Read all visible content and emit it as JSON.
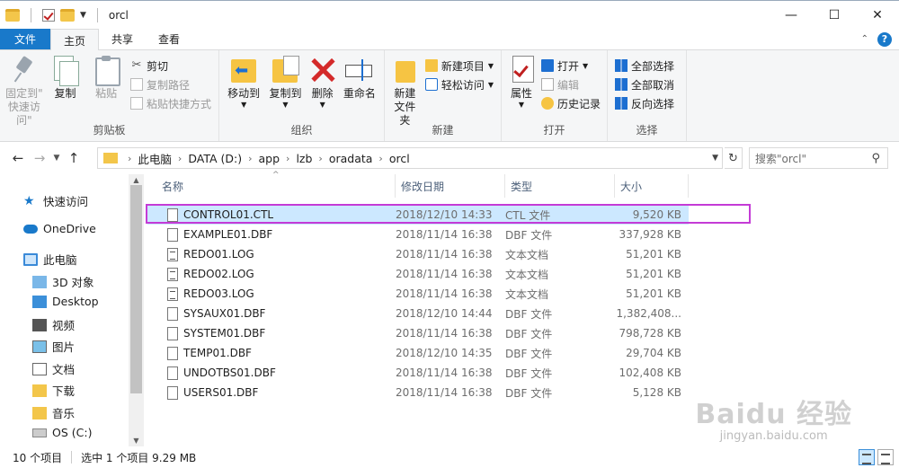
{
  "window": {
    "title": "orcl",
    "minimize": "—",
    "maximize": "☐",
    "close": "✕"
  },
  "ribbon_tabs": [
    {
      "label": "文件"
    },
    {
      "label": "主页"
    },
    {
      "label": "共享"
    },
    {
      "label": "查看"
    }
  ],
  "ribbon": {
    "clipboard": {
      "label": "剪贴板",
      "pin": "固定到\"\n快速访问\"",
      "copy": "复制",
      "paste": "粘贴",
      "cut": "剪切",
      "copy_path": "复制路径",
      "paste_shortcut": "粘贴快捷方式"
    },
    "organize": {
      "label": "组织",
      "move_to": "移动到",
      "copy_to": "复制到",
      "delete": "删除",
      "rename": "重命名"
    },
    "new": {
      "label": "新建",
      "new_folder": "新建\n文件夹",
      "new_item": "新建项目",
      "easy_access": "轻松访问"
    },
    "open": {
      "label": "打开",
      "properties": "属性",
      "open": "打开",
      "edit": "编辑",
      "history": "历史记录"
    },
    "select": {
      "label": "选择",
      "select_all": "全部选择",
      "select_none": "全部取消",
      "invert": "反向选择"
    }
  },
  "address": {
    "crumbs": [
      "此电脑",
      "DATA (D:)",
      "app",
      "lzb",
      "oradata",
      "orcl"
    ],
    "search_placeholder": "搜索\"orcl\""
  },
  "nav": {
    "quick_access": "快速访问",
    "onedrive": "OneDrive",
    "this_pc": "此电脑",
    "items": [
      "3D 对象",
      "Desktop",
      "视频",
      "图片",
      "文档",
      "下载",
      "音乐",
      "OS (C:)"
    ]
  },
  "columns": {
    "name": "名称",
    "date": "修改日期",
    "type": "类型",
    "size": "大小"
  },
  "files": [
    {
      "name": "CONTROL01.CTL",
      "date": "2018/12/10 14:33",
      "type": "CTL 文件",
      "size": "9,520 KB"
    },
    {
      "name": "EXAMPLE01.DBF",
      "date": "2018/11/14 16:38",
      "type": "DBF 文件",
      "size": "337,928 KB"
    },
    {
      "name": "REDO01.LOG",
      "date": "2018/11/14 16:38",
      "type": "文本文档",
      "size": "51,201 KB"
    },
    {
      "name": "REDO02.LOG",
      "date": "2018/11/14 16:38",
      "type": "文本文档",
      "size": "51,201 KB"
    },
    {
      "name": "REDO03.LOG",
      "date": "2018/11/14 16:38",
      "type": "文本文档",
      "size": "51,201 KB"
    },
    {
      "name": "SYSAUX01.DBF",
      "date": "2018/12/10 14:44",
      "type": "DBF 文件",
      "size": "1,382,408..."
    },
    {
      "name": "SYSTEM01.DBF",
      "date": "2018/11/14 16:38",
      "type": "DBF 文件",
      "size": "798,728 KB"
    },
    {
      "name": "TEMP01.DBF",
      "date": "2018/12/10 14:35",
      "type": "DBF 文件",
      "size": "29,704 KB"
    },
    {
      "name": "UNDOTBS01.DBF",
      "date": "2018/11/14 16:38",
      "type": "DBF 文件",
      "size": "102,408 KB"
    },
    {
      "name": "USERS01.DBF",
      "date": "2018/11/14 16:38",
      "type": "DBF 文件",
      "size": "5,128 KB"
    }
  ],
  "status": {
    "count": "10 个项目",
    "selected": "选中 1 个项目  9.29 MB"
  },
  "watermark": {
    "logo": "Baidu 经验",
    "url": "jingyan.baidu.com"
  },
  "colors": {
    "file_tab": "#1979ca",
    "selection": "#cce8ff",
    "highlight_border": "#c43bd6"
  }
}
